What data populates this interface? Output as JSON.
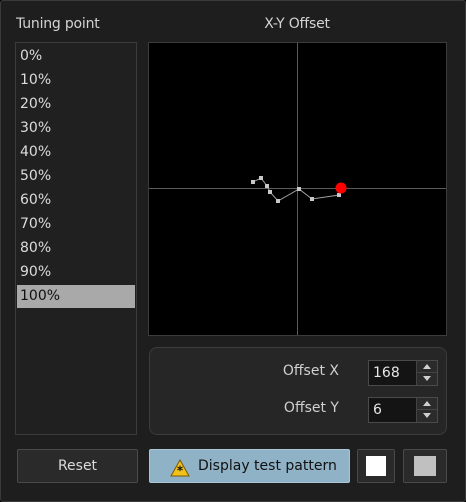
{
  "headers": {
    "tuning_point": "Tuning point",
    "xy_offset": "X-Y Offset"
  },
  "tuning_points": {
    "items": [
      "0%",
      "10%",
      "20%",
      "30%",
      "40%",
      "50%",
      "60%",
      "70%",
      "80%",
      "90%",
      "100%"
    ],
    "selected": "100%"
  },
  "plot": {
    "marker_color": "#ff0000",
    "curve_color": "#a0a0a0",
    "crosshair_color": "#5a5a5a"
  },
  "offset": {
    "x_label": "Offset X",
    "x_value": "168",
    "y_label": "Offset Y",
    "y_value": "6"
  },
  "buttons": {
    "reset": "Reset",
    "display_test_pattern": "Display test pattern",
    "white_swatch_color": "#ffffff",
    "gray_swatch_color": "#c0c0c0",
    "warning_icon": "warning-asterisk-icon",
    "accent_color": "#8fb2c6"
  }
}
